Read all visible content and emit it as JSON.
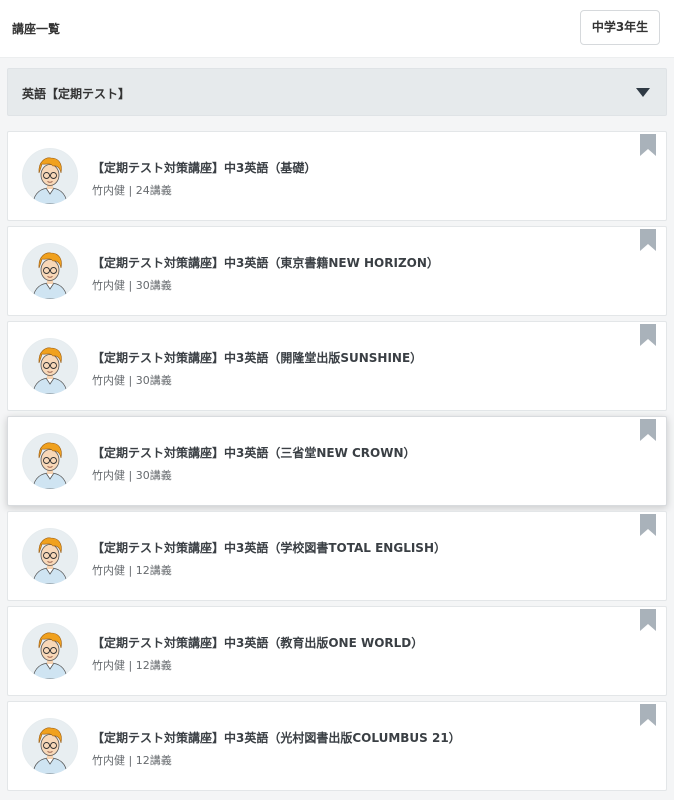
{
  "header": {
    "title": "講座一覧",
    "grade_button": "中学3年生"
  },
  "category": {
    "label": "英語【定期テスト】",
    "icon": "caret-down-icon"
  },
  "courses": [
    {
      "title": "【定期テスト対策講座】中3英語（基礎）",
      "teacher": "竹内健",
      "lessons": "24講義",
      "meta": "竹内健 | 24講義"
    },
    {
      "title": "【定期テスト対策講座】中3英語（東京書籍NEW HORIZON）",
      "teacher": "竹内健",
      "lessons": "30講義",
      "meta": "竹内健 | 30講義"
    },
    {
      "title": "【定期テスト対策講座】中3英語（開隆堂出版SUNSHINE）",
      "teacher": "竹内健",
      "lessons": "30講義",
      "meta": "竹内健 | 30講義"
    },
    {
      "title": "【定期テスト対策講座】中3英語（三省堂NEW CROWN）",
      "teacher": "竹内健",
      "lessons": "30講義",
      "meta": "竹内健 | 30講義"
    },
    {
      "title": "【定期テスト対策講座】中3英語（学校図書TOTAL ENGLISH）",
      "teacher": "竹内健",
      "lessons": "12講義",
      "meta": "竹内健 | 12講義"
    },
    {
      "title": "【定期テスト対策講座】中3英語（教育出版ONE WORLD）",
      "teacher": "竹内健",
      "lessons": "12講義",
      "meta": "竹内健 | 12講義"
    },
    {
      "title": "【定期テスト対策講座】中3英語（光村図書出版COLUMBUS 21）",
      "teacher": "竹内健",
      "lessons": "12講義",
      "meta": "竹内健 | 12講義"
    }
  ],
  "colors": {
    "background": "#f4f5f6",
    "category_bg": "#e6eaec",
    "bookmark": "#a9b2ba",
    "hair": "#f0a11e",
    "text": "#3a3f44"
  }
}
